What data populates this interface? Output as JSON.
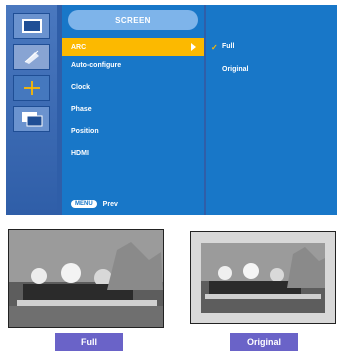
{
  "osd": {
    "header": "SCREEN",
    "menu_items": [
      {
        "label": "ARC",
        "selected": true
      },
      {
        "label": "Auto-configure",
        "selected": false
      },
      {
        "label": "Clock",
        "selected": false
      },
      {
        "label": "Phase",
        "selected": false
      },
      {
        "label": "Position",
        "selected": false
      },
      {
        "label": "HDMI",
        "selected": false
      }
    ],
    "footer": {
      "button": "MENU",
      "label": "Prev"
    },
    "options": [
      {
        "label": "Full",
        "checked": true
      },
      {
        "label": "Original",
        "checked": false
      }
    ],
    "check_mark": "✓"
  },
  "examples": {
    "full_label": "Full",
    "original_label": "Original"
  },
  "colors": {
    "menu_bg": "#1877c8",
    "selected_bg": "#fcb900",
    "label_bg": "#6a63c8"
  },
  "icons": [
    "picture-icon",
    "adjust-icon",
    "move-icon",
    "screen-icon"
  ]
}
